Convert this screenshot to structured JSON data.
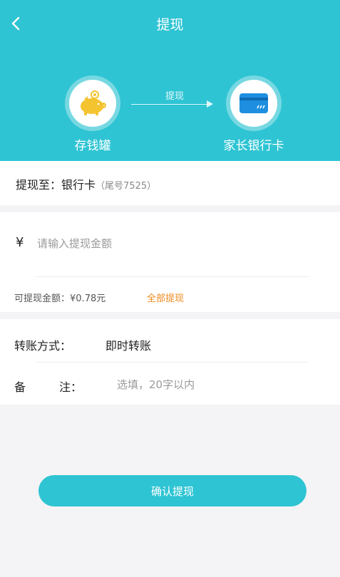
{
  "header": {
    "title": "提现",
    "back_icon": "chevron-left-icon",
    "from_label": "存钱罐",
    "from_icon": "piggy-bank-icon",
    "arrow_label": "提现",
    "to_label": "家长银行卡",
    "to_icon": "bank-card-icon",
    "bg_color": "#2ec4d3"
  },
  "destination": {
    "label": "提现至：",
    "value": "银行卡",
    "tail": "（尾号7525）"
  },
  "amount": {
    "currency": "¥",
    "placeholder": "请输入提现金额",
    "available_label": "可提现金额：",
    "available_value": "¥0.78元",
    "withdraw_all": "全部提现",
    "withdraw_all_color": "#f08a1c"
  },
  "method": {
    "label": "转账方式：",
    "value": "即时转账"
  },
  "note": {
    "label_first": "备",
    "label_last": "注：",
    "placeholder": "选填，20字以内"
  },
  "confirm_button": {
    "label": "确认提现",
    "color": "#2ec4d3"
  }
}
